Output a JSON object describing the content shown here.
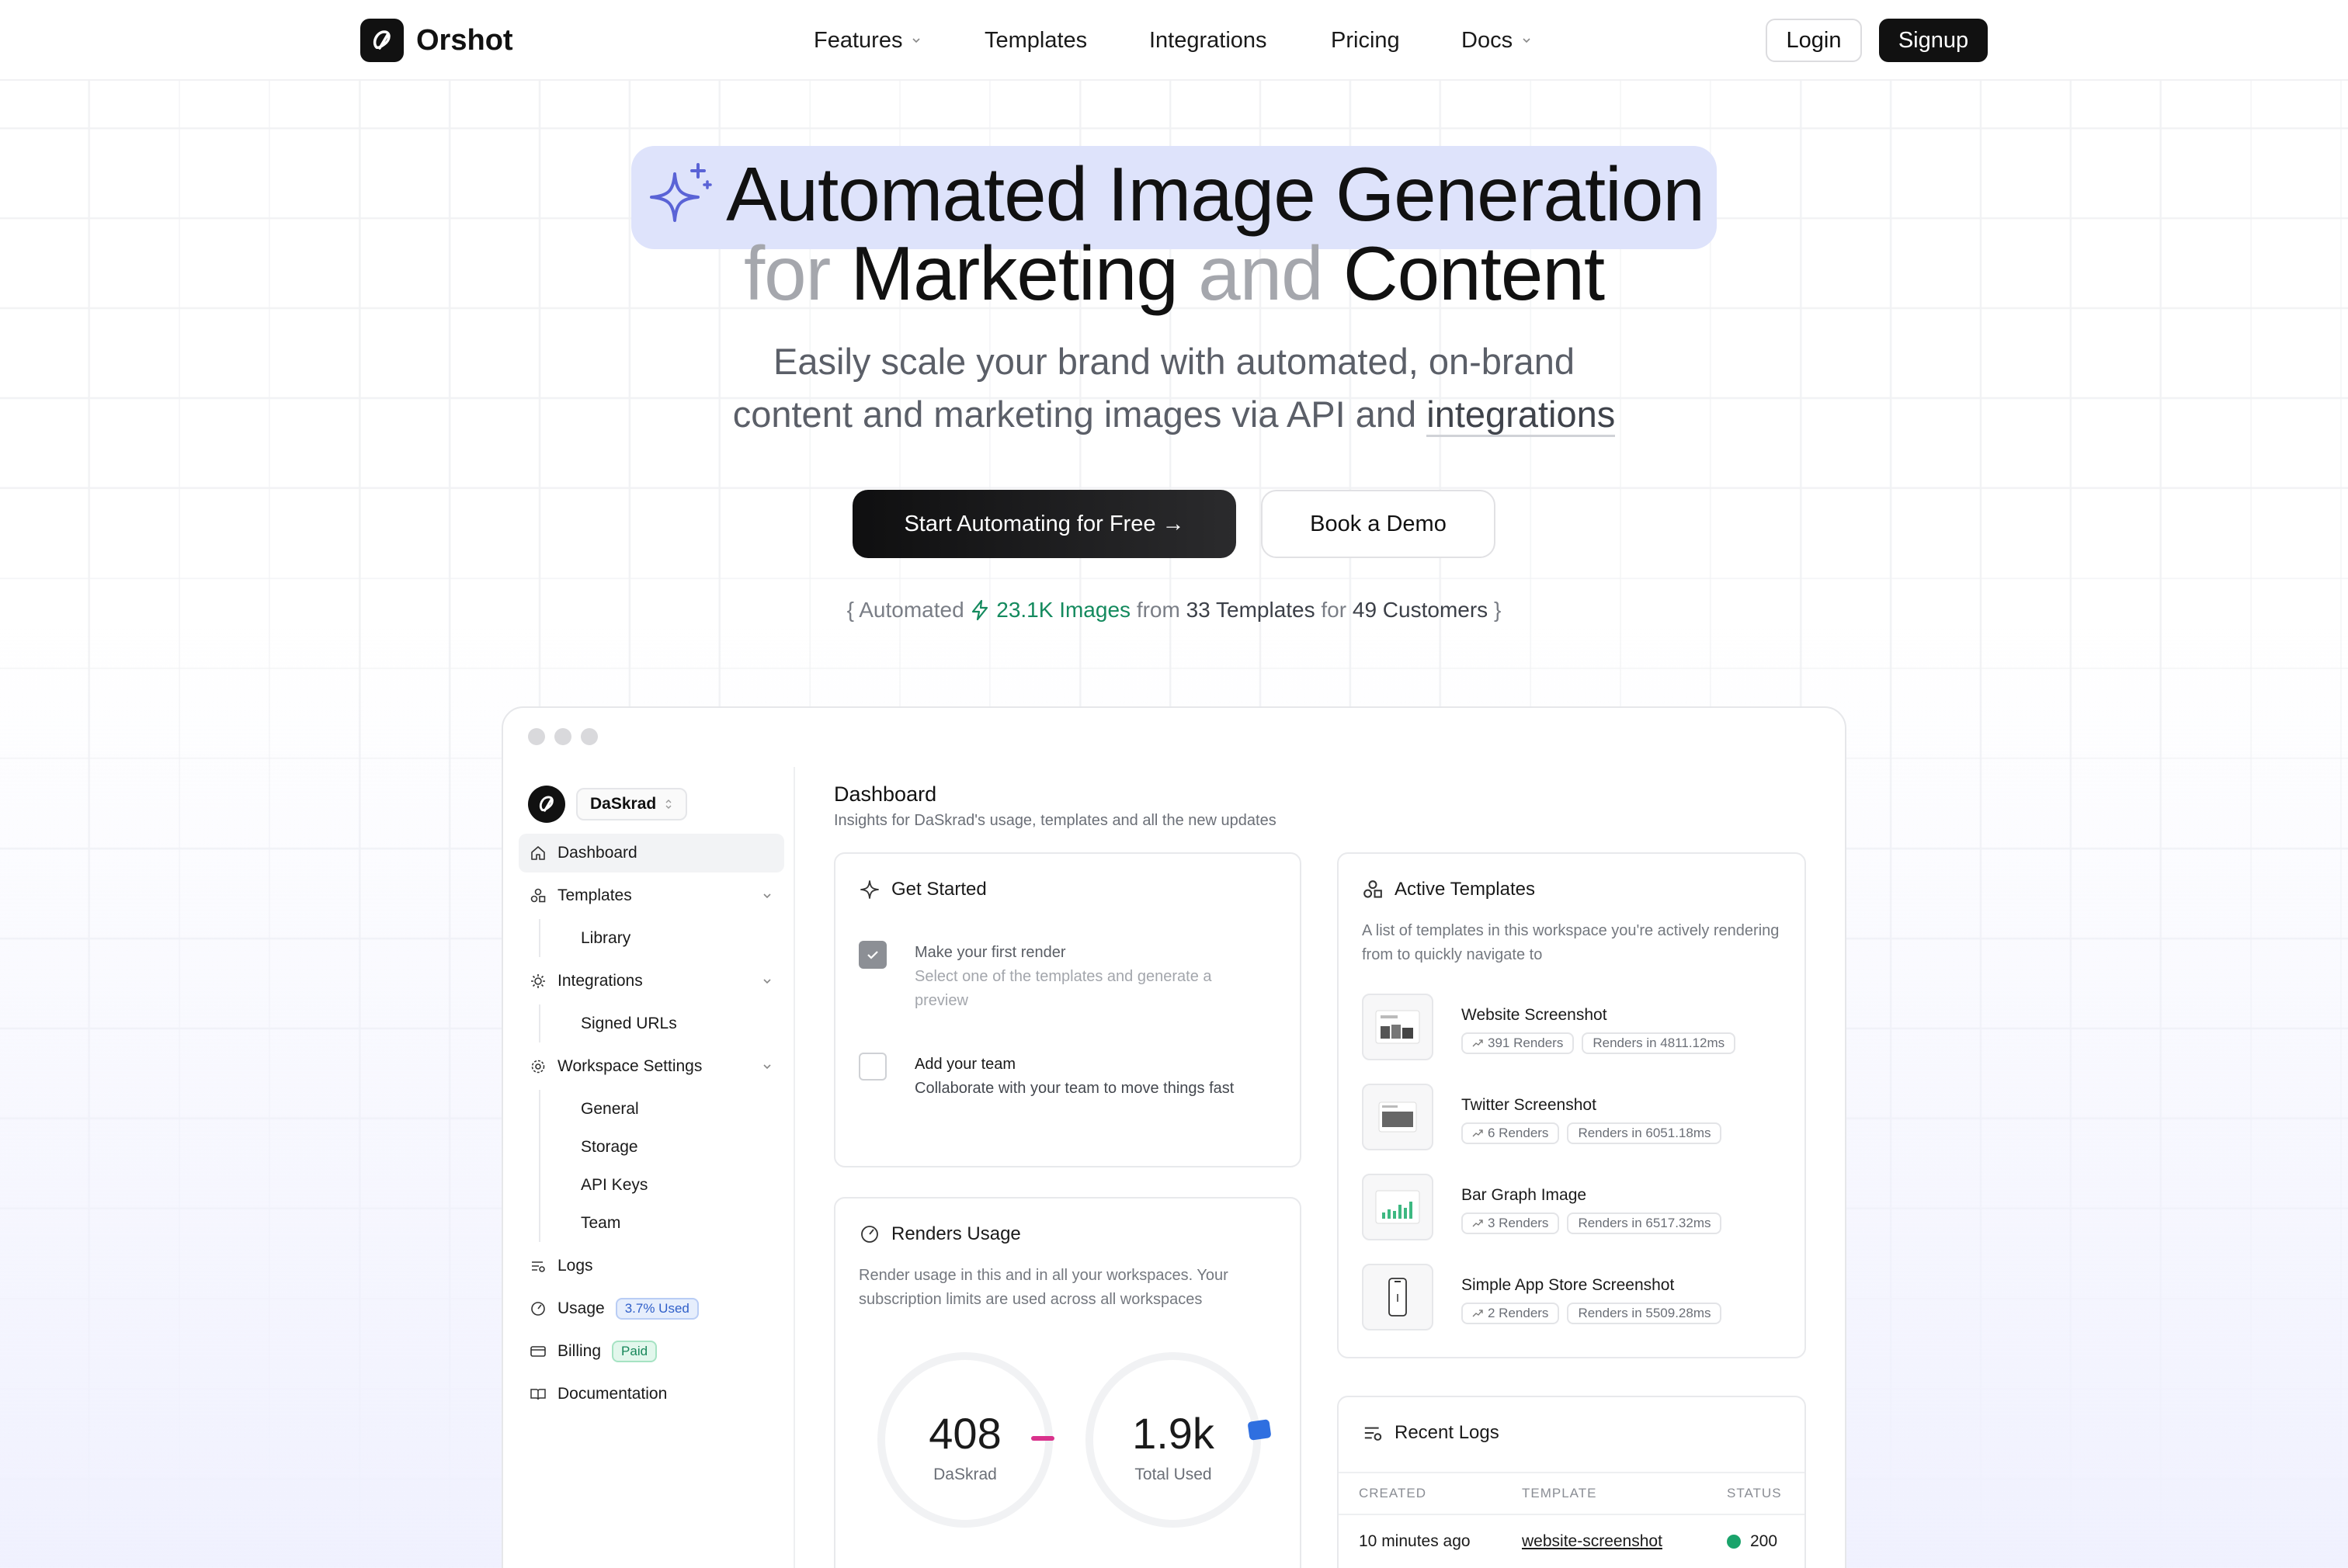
{
  "brand": {
    "name": "Orshot"
  },
  "nav": [
    {
      "label": "Features",
      "dropdown": true
    },
    {
      "label": "Templates",
      "dropdown": false
    },
    {
      "label": "Integrations",
      "dropdown": false
    },
    {
      "label": "Pricing",
      "dropdown": false
    },
    {
      "label": "Docs",
      "dropdown": true
    }
  ],
  "auth": {
    "login": "Login",
    "signup": "Signup"
  },
  "hero": {
    "line1": "Automated Image Generation",
    "line2_a": "for",
    "line2_b": "Marketing",
    "line2_c": "and",
    "line2_d": "Content",
    "sub1": "Easily scale your brand with automated, on-brand",
    "sub2_a": "content and marketing images via API and",
    "sub2_link": "integrations",
    "cta_primary": "Start Automating for Free →",
    "cta_secondary": "Book a Demo"
  },
  "stats": {
    "open": "{ Automated",
    "images": "23.1K Images",
    "from": "from",
    "templates": "33 Templates",
    "for": "for",
    "customers": "49 Customers",
    "close": "}"
  },
  "app": {
    "workspace": "DaSkrad",
    "menu": {
      "dashboard": "Dashboard",
      "templates": "Templates",
      "library": "Library",
      "integrations": "Integrations",
      "signed_urls": "Signed URLs",
      "workspace_settings": "Workspace Settings",
      "general": "General",
      "storage": "Storage",
      "api_keys": "API Keys",
      "team": "Team",
      "logs": "Logs",
      "usage": "Usage",
      "usage_badge": "3.7% Used",
      "billing": "Billing",
      "billing_badge": "Paid",
      "documentation": "Documentation"
    },
    "dashboard": {
      "title": "Dashboard",
      "subtitle": "Insights for DaSkrad's usage, templates and all the new updates"
    },
    "get_started": {
      "title": "Get Started",
      "task1_title": "Make your first render",
      "task1_desc": "Select one of the templates and generate a preview",
      "task1_done": true,
      "task2_title": "Add your team",
      "task2_desc": "Collaborate with your team to move things fast",
      "task2_done": false
    },
    "renders_usage": {
      "title": "Renders Usage",
      "desc": "Render usage in this and in all your workspaces. Your subscription limits are used across all workspaces",
      "ring1_value": "408",
      "ring1_label": "DaSkrad",
      "ring2_value": "1.9k",
      "ring2_label": "Total Used",
      "accent1": "#d9328c",
      "accent2": "#2f6fe0"
    },
    "active_templates": {
      "title": "Active Templates",
      "desc": "A list of templates in this workspace you're actively rendering from to quickly navigate to",
      "items": [
        {
          "name": "Website Screenshot",
          "renders": "391 Renders",
          "time": "Renders in 4811.12ms",
          "icon": "website-thumb-icon"
        },
        {
          "name": "Twitter Screenshot",
          "renders": "6 Renders",
          "time": "Renders in 6051.18ms",
          "icon": "twitter-thumb-icon"
        },
        {
          "name": "Bar Graph Image",
          "renders": "3 Renders",
          "time": "Renders in 6517.32ms",
          "icon": "bar-graph-thumb-icon"
        },
        {
          "name": "Simple App Store Screenshot",
          "renders": "2 Renders",
          "time": "Renders in 5509.28ms",
          "icon": "phone-thumb-icon"
        }
      ]
    },
    "recent_logs": {
      "title": "Recent Logs",
      "col_created": "CREATED",
      "col_template": "TEMPLATE",
      "col_status": "STATUS",
      "row_created": "10 minutes ago",
      "row_template": "website-screenshot",
      "row_status": "200",
      "status_color": "#1aa36b"
    }
  }
}
